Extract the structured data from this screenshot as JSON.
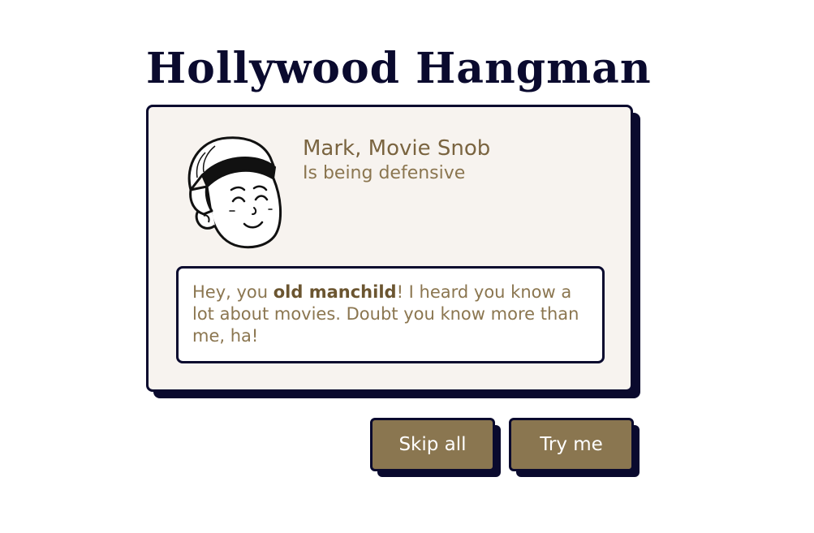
{
  "game": {
    "title": "Hollywood Hangman"
  },
  "character": {
    "name": "Mark, Movie Snob",
    "status": "Is being defensive",
    "avatar_icon": "boy-with-beanie-avatar-icon"
  },
  "dialogue": {
    "before": "Hey, you ",
    "emphasis": "old manchild",
    "after": "! I heard you know a lot about movies. Doubt you know more than me, ha!"
  },
  "buttons": {
    "skip_label": "Skip all",
    "try_label": "Try me"
  },
  "colors": {
    "navy": "#0a0a2e",
    "card_bg": "#f7f3ef",
    "accent_brown": "#8a7650",
    "text_brown": "#7a6440"
  }
}
